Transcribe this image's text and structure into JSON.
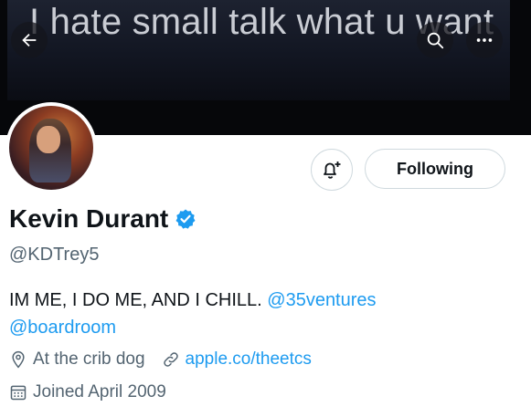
{
  "banner": {
    "text": "I hate small talk what u want",
    "bg_color": "#121622"
  },
  "nav": {
    "back_icon": "arrow-left-icon",
    "search_icon": "search-icon",
    "more_icon": "more-dots-icon"
  },
  "actions": {
    "notify_icon": "bell-plus-icon",
    "follow_label": "Following"
  },
  "profile": {
    "name": "Kevin Durant",
    "verified_icon": "verified-badge-icon",
    "verified_color": "#1d9bf0",
    "handle": "@KDTrey5",
    "bio_text": "IM ME, I DO ME, AND I CHILL. ",
    "bio_mention_1": "@35ventures",
    "bio_mention_2": "@boardroom",
    "location": "At the crib dog",
    "website": "apple.co/theetcs",
    "joined": "Joined April 2009"
  },
  "colors": {
    "accent": "#1d9bf0",
    "secondary_text": "#536471",
    "primary_text": "#0f1419"
  }
}
